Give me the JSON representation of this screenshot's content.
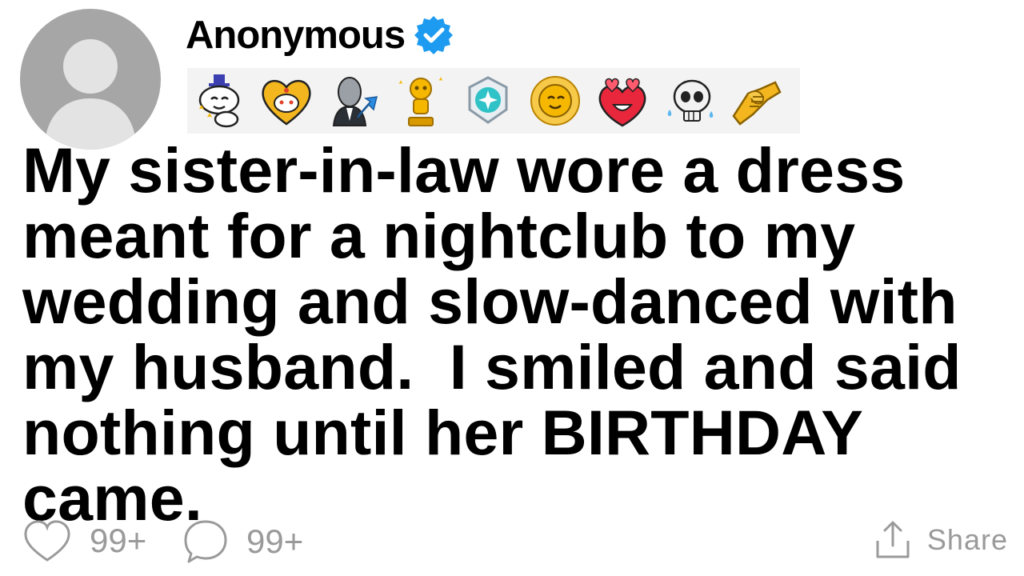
{
  "post": {
    "username": "Anonymous",
    "verified": true,
    "title": "My sister-in-law wore a dress meant for a nightclub to my wedding and slow-danced with my husband.  I smiled and said nothing until her BIRTHDAY came."
  },
  "awards": [
    {
      "icon": "top-hat-snoo-award-icon"
    },
    {
      "icon": "heart-snoo-award-icon"
    },
    {
      "icon": "stonks-award-icon"
    },
    {
      "icon": "gold-trophy-snoo-award-icon"
    },
    {
      "icon": "platinum-award-icon"
    },
    {
      "icon": "sun-face-award-icon"
    },
    {
      "icon": "heart-eyes-award-icon"
    },
    {
      "icon": "crying-skull-award-icon"
    },
    {
      "icon": "handshake-award-icon"
    }
  ],
  "footer": {
    "likes": "99+",
    "comments": "99+",
    "share_label": "Share"
  },
  "colors": {
    "verified_blue": "#1d9bf0",
    "muted_gray": "#9a9a9a",
    "avatar_gray": "#a6a6a6"
  }
}
